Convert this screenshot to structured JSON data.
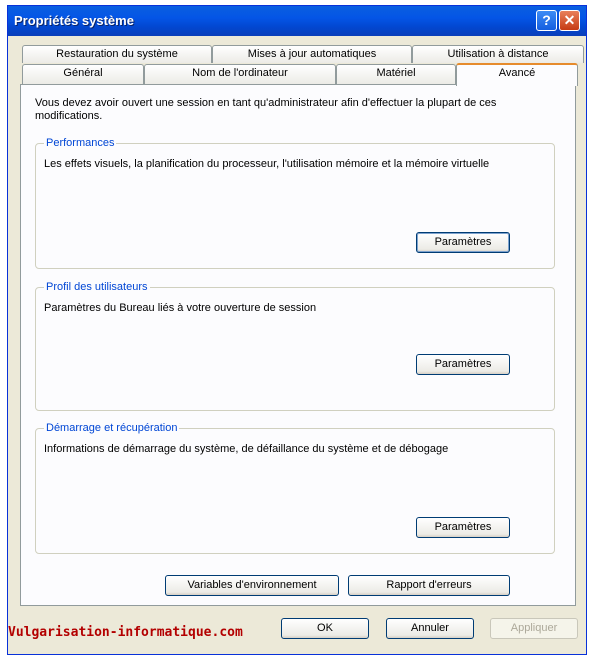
{
  "window": {
    "title": "Propriétés système"
  },
  "titlebar_buttons": {
    "help": "?",
    "close": "✕"
  },
  "tabs_row1": [
    "Restauration du système",
    "Mises à jour automatiques",
    "Utilisation à distance"
  ],
  "tabs_row2": [
    "Général",
    "Nom de l'ordinateur",
    "Matériel",
    "Avancé"
  ],
  "active_tab": "Avancé",
  "intro": "Vous devez avoir ouvert une session en tant qu'administrateur afin d'effectuer la plupart de ces modifications.",
  "groups": [
    {
      "label": "Performances",
      "text": "Les effets visuels, la planification du processeur, l'utilisation mémoire et la mémoire virtuelle",
      "button": "Paramètres"
    },
    {
      "label": "Profil des utilisateurs",
      "text": "Paramètres du Bureau liés à votre ouverture de session",
      "button": "Paramètres"
    },
    {
      "label": "Démarrage et récupération",
      "text": "Informations de démarrage du système, de défaillance du système et de débogage",
      "button": "Paramètres"
    }
  ],
  "panel_buttons": {
    "env": "Variables d'environnement",
    "errors": "Rapport d'erreurs"
  },
  "footer": {
    "watermark": "Vulgarisation-informatique.com",
    "ok": "OK",
    "cancel": "Annuler",
    "apply": "Appliquer"
  }
}
